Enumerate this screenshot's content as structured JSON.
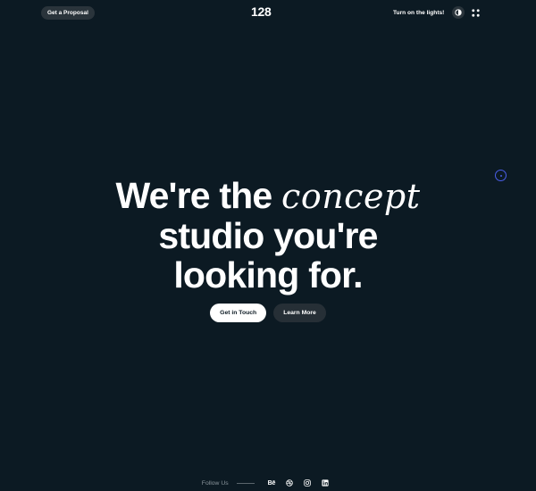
{
  "header": {
    "proposal_button": "Get a Proposal",
    "logo": "128",
    "lights_label": "Turn on the lights!",
    "theme_toggle_icon": "contrast-icon",
    "menu_icon": "grid-dots-icon"
  },
  "hero": {
    "line1_prefix": "We're the",
    "line1_accent": "concept",
    "line2": "studio you're",
    "line3": "looking for."
  },
  "cta": {
    "primary": "Get in Touch",
    "secondary": "Learn More"
  },
  "footer": {
    "follow_label": "Follow Us",
    "social": {
      "behance_label": "Bē",
      "behance_icon": "behance-icon",
      "dribbble_icon": "dribbble-icon",
      "instagram_icon": "instagram-icon",
      "linkedin_icon": "linkedin-icon"
    }
  },
  "colors": {
    "background": "#0c1a23",
    "button_dark": "#2a343b",
    "cursor_accent": "#4a5ee8"
  }
}
